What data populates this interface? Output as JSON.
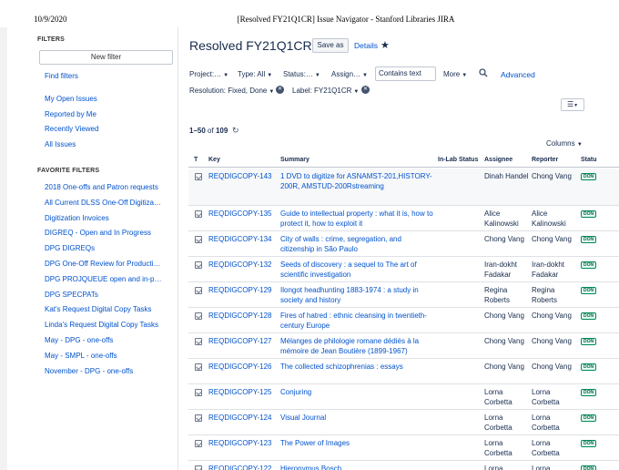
{
  "print": {
    "date": "10/9/2020",
    "title": "[Resolved FY21Q1CR] Issue Navigator - Stanford Libraries JIRA"
  },
  "sidebar": {
    "filters_heading": "FILTERS",
    "new_filter_label": "New filter",
    "find_filters": "Find filters",
    "system_filters": [
      "My Open Issues",
      "Reported by Me",
      "Recently Viewed",
      "All Issues"
    ],
    "favorite_heading": "FAVORITE FILTERS",
    "favorite_filters": [
      "2018 One-offs and Patron requests",
      "All Current DLSS One-Off Digitiza…",
      "Digitization Invoices",
      "DIGREQ - Open and In Progress",
      "DPG DIGREQs",
      "DPG One-Off Review for Producti…",
      "DPG PROJQUEUE open and in-p…",
      "DPG SPECPATs",
      "Kat's Request Digital Copy Tasks",
      "Linda's Request Digital Copy Tasks",
      "May - DPG - one-offs",
      "May - SMPL - one-offs",
      "November - DPG - one-offs"
    ]
  },
  "header": {
    "title": "Resolved FY21Q1CR",
    "save_as": "Save as",
    "details": "Details",
    "star_icon": "star-icon"
  },
  "search": {
    "project": "Project:…",
    "type": "Type: All",
    "status": "Status:…",
    "assignee": "Assign…",
    "contains_text": "Contains text",
    "more": "More",
    "advanced": "Advanced",
    "resolution": "Resolution: Fixed, Done",
    "label": "Label: FY21Q1CR"
  },
  "results": {
    "range": "1–50",
    "of_label": "of",
    "total": "109",
    "columns_label": "Columns"
  },
  "table": {
    "headers": {
      "type": "T",
      "key": "Key",
      "summary": "Summary",
      "in_lab_status": "In-Lab Status",
      "assignee": "Assignee",
      "reporter": "Reporter",
      "status": "Statu"
    },
    "rows": [
      {
        "key": "REQDIGCOPY-143",
        "summary": "1 DVD to digitize for ASNAMST-201,HISTORY-200R, AMSTUD-200Rstreaming",
        "assignee": "Dinah Handel",
        "reporter": "Chong Vang",
        "status": "DON"
      },
      {
        "key": "REQDIGCOPY-135",
        "summary": "Guide to intellectual property : what it is, how to protect it, how to exploit it",
        "assignee": "Alice Kalinowski",
        "reporter": "Alice Kalinowski",
        "status": "DON"
      },
      {
        "key": "REQDIGCOPY-134",
        "summary": "City of walls : crime, segregation, and citizenship in São Paulo",
        "assignee": "Chong Vang",
        "reporter": "Chong Vang",
        "status": "DON"
      },
      {
        "key": "REQDIGCOPY-132",
        "summary": "Seeds of discovery : a sequel to The art of scientific investigation",
        "assignee": "Iran-dokht Fadakar",
        "reporter": "Iran-dokht Fadakar",
        "status": "DON"
      },
      {
        "key": "REQDIGCOPY-129",
        "summary": "Ilongot headhunting 1883-1974 : a study in society and history",
        "assignee": "Regina Roberts",
        "reporter": "Regina Roberts",
        "status": "DON"
      },
      {
        "key": "REQDIGCOPY-128",
        "summary": "Fires of hatred : ethnic cleansing in twentieth-century Europe",
        "assignee": "Chong Vang",
        "reporter": "Chong Vang",
        "status": "DON"
      },
      {
        "key": "REQDIGCOPY-127",
        "summary": "Mélanges de philologie romane dédiés à la mémoire de Jean Boutière (1899-1967)",
        "assignee": "Chong Vang",
        "reporter": "Chong Vang",
        "status": "DON"
      },
      {
        "key": "REQDIGCOPY-126",
        "summary": "The collected schizophrenias : essays",
        "assignee": "Chong Vang",
        "reporter": "Chong Vang",
        "status": "DON"
      },
      {
        "key": "REQDIGCOPY-125",
        "summary": "Conjuring",
        "assignee": "Lorna Corbetta",
        "reporter": "Lorna Corbetta",
        "status": "DON"
      },
      {
        "key": "REQDIGCOPY-124",
        "summary": "Visual Journal",
        "assignee": "Lorna Corbetta",
        "reporter": "Lorna Corbetta",
        "status": "DON"
      },
      {
        "key": "REQDIGCOPY-123",
        "summary": "The Power of Images",
        "assignee": "Lorna Corbetta",
        "reporter": "Lorna Corbetta",
        "status": "DON"
      },
      {
        "key": "REQDIGCOPY-122",
        "summary": "Hieronymus Bosch",
        "assignee": "Lorna",
        "reporter": "Lorna",
        "status": "DON"
      }
    ]
  },
  "colors": {
    "link": "#0052cc",
    "text": "#172b4d",
    "done_status": "#00875a"
  }
}
